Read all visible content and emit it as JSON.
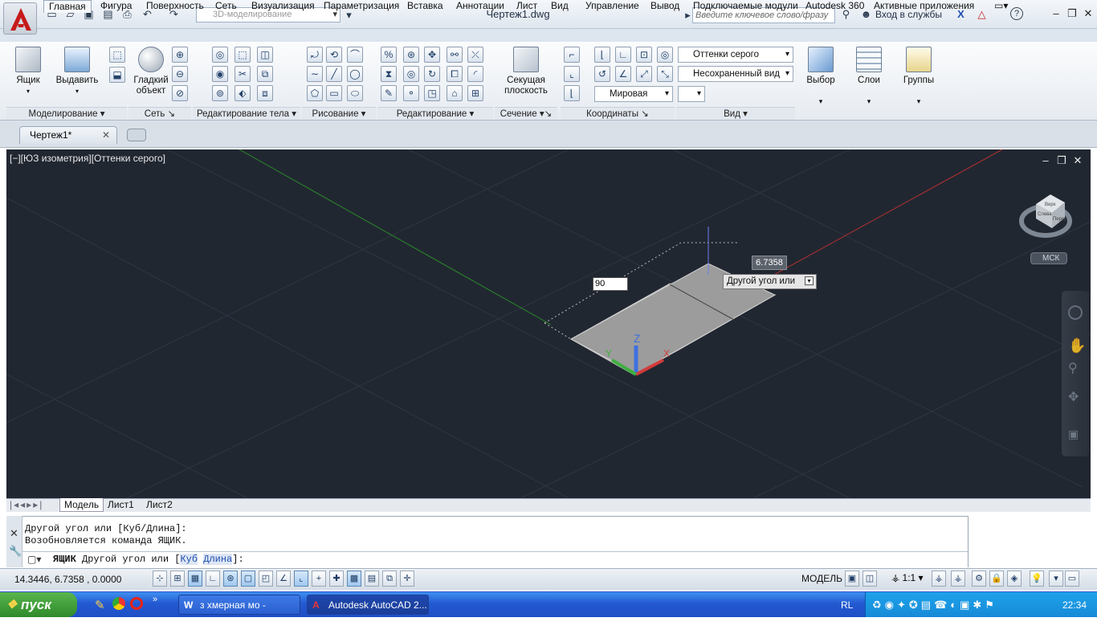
{
  "window": {
    "workspace": "3D-моделирование",
    "doc_title": "Чертеж1.dwg",
    "search_placeholder": "Введите ключевое слово/фразу",
    "sign_in": "Вход в службы"
  },
  "ribbon_tabs": [
    "Главная",
    "Фигура",
    "Поверхность",
    "Сеть",
    "Визуализация",
    "Параметризация",
    "Вставка",
    "Аннотации",
    "Лист",
    "Вид",
    "Управление",
    "Вывод",
    "Подключаемые модули",
    "Autodesk 360",
    "Активные приложения"
  ],
  "ribbon": {
    "box_label": "Ящик",
    "extrude_label": "Выдавить",
    "smooth_label_1": "Гладкий",
    "smooth_label_2": "объект",
    "section_label_1": "Секущая",
    "section_label_2": "плоскость",
    "visual_style": "Оттенки серого",
    "view_name": "Несохраненный вид",
    "ucs": "Мировая",
    "select_label": "Выбор",
    "layers_label": "Слои",
    "groups_label": "Группы",
    "panels": [
      "Моделирование",
      "Сеть",
      "Редактирование тела",
      "Рисование",
      "Редактирование",
      "Сечение",
      "Координаты",
      "Вид"
    ]
  },
  "doc_tab": "Чертеж1*",
  "viewport": {
    "label": "[−][ЮЗ изометрия][Оттенки серого]",
    "dim_value": "6.7358",
    "prompt": "Другой угол или",
    "input_value": "90",
    "ucs_badge": "МСК",
    "axis_x": "X",
    "axis_y": "Y",
    "axis_z": "Z",
    "cube_top": "Верх",
    "cube_left": "Слева",
    "cube_front": "Перед"
  },
  "layout_tabs": [
    "Модель",
    "Лист1",
    "Лист2"
  ],
  "command": {
    "history_1": "Другой угол или [Куб/Длина]:",
    "history_2": "Возобновляется команда ЯЩИК.",
    "current_cmd": "ЯЩИК",
    "current_prompt": "Другой угол или [",
    "opt1": "Куб",
    "opt2": "Длина",
    "prompt_end": "]:"
  },
  "status": {
    "coords": "14.3446, 6.7358 , 0.0000",
    "model": "МОДЕЛЬ",
    "scale": "1:1"
  },
  "taskbar": {
    "start": "пуск",
    "task1": "з хмерная мо - Micro...",
    "task2": "Autodesk AutoCAD 2...",
    "lang": "RL",
    "clock": "22:34"
  },
  "colors": {
    "viewport_bg": "#212731",
    "axis_x": "#d33b3b",
    "axis_y": "#3fae3f",
    "axis_z": "#3f6fe0",
    "taskbar": "#245ad4"
  }
}
